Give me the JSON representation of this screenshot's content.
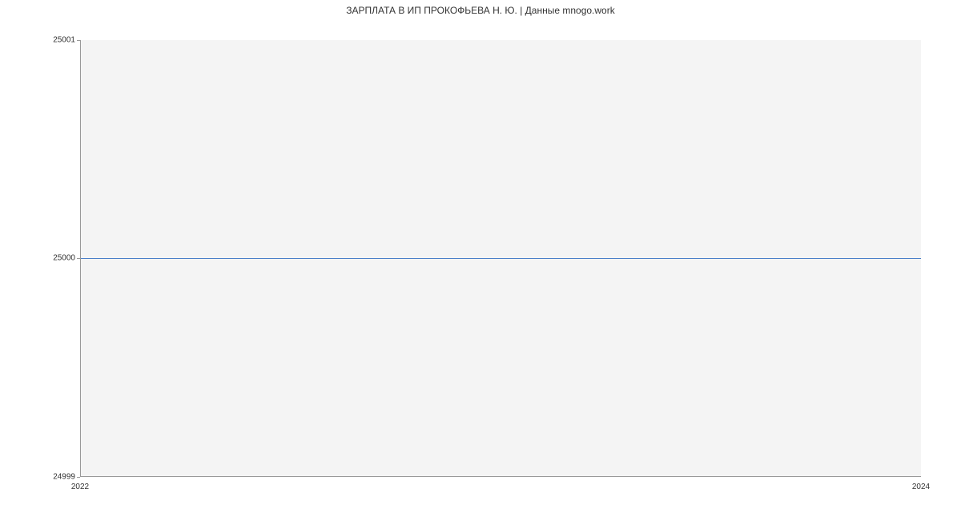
{
  "chart_data": {
    "type": "line",
    "title": "ЗАРПЛАТА В ИП ПРОКОФЬЕВА Н. Ю. | Данные mnogo.work",
    "x": [
      2022,
      2024
    ],
    "values": [
      25000,
      25000
    ],
    "xlabel": "",
    "ylabel": "",
    "xlim": [
      2022,
      2024
    ],
    "ylim": [
      24999,
      25001
    ],
    "x_ticks": [
      "2022",
      "2024"
    ],
    "y_ticks": [
      "24999",
      "25000",
      "25001"
    ],
    "line_color": "#4a7fc9",
    "plot_bg": "#f4f4f4"
  }
}
